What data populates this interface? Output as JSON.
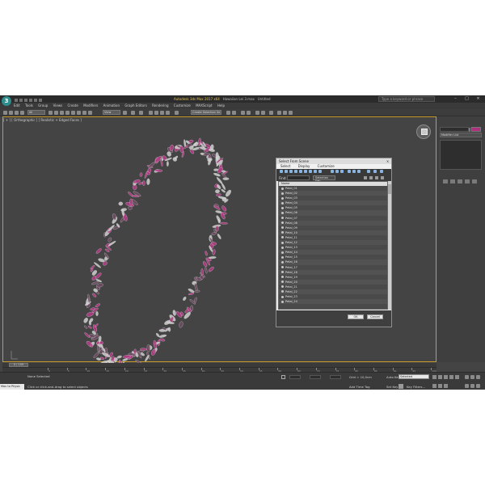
{
  "app": {
    "title_prefix": "Autodesk 3ds Max 2017 x64",
    "title_file": "Hawaiian Lei 3.max",
    "title_mode": "Untitled",
    "search_placeholder": "Type a keyword or phrase",
    "logo": "3"
  },
  "menu": [
    "Edit",
    "Tools",
    "Group",
    "Views",
    "Create",
    "Modifiers",
    "Animation",
    "Graph Editors",
    "Rendering",
    "Customize",
    "MAXScript",
    "Help"
  ],
  "toolbar": {
    "selection_filter": "All",
    "view": "View",
    "named_selection": "Create Selection Se"
  },
  "viewport": {
    "label": "[ + ] [ Orthographic ] [ Realistic + Edged Faces ]",
    "petal_colors": {
      "petal_light": "#cfcfcf",
      "petal_pink": "#b53c86",
      "petal_dark": "#6e4a62"
    }
  },
  "command_panel": {
    "modifier_list": "Modifier List",
    "object_color": "#b03080"
  },
  "dialog": {
    "title": "Select From Scene",
    "close": "×",
    "menu": [
      "Select",
      "Display",
      "Customize"
    ],
    "find_label": "Find:",
    "selection_set": "Selection Set:",
    "column_name": "Name",
    "items": [
      "Petal_01",
      "Petal_02",
      "Petal_03",
      "Petal_04",
      "Petal_05",
      "Petal_06",
      "Petal_07",
      "Petal_08",
      "Petal_09",
      "Petal_10",
      "Petal_11",
      "Petal_12",
      "Petal_13",
      "Petal_14",
      "Petal_15",
      "Petal_16",
      "Petal_17",
      "Petal_18",
      "Petal_19",
      "Petal_20",
      "Petal_21",
      "Petal_22",
      "Petal_23",
      "Petal_24"
    ],
    "ok": "OK",
    "cancel": "Cancel"
  },
  "timeline": {
    "slider": "0 / 100",
    "ticks": [
      "0",
      "5",
      "10",
      "15",
      "20",
      "25",
      "30",
      "35",
      "40",
      "45",
      "50",
      "55",
      "60",
      "65",
      "70",
      "75",
      "80",
      "85",
      "90",
      "95",
      "100"
    ]
  },
  "status": {
    "maxscript": "Max to Physic",
    "selection": "None Selected",
    "hint": "Click or click-and-drag to select objects",
    "grid": "Grid = 10,0cm",
    "add_time_tag": "Add Time Tag",
    "auto_key": "Auto Key",
    "selected": "Selected",
    "set_key": "Set Key",
    "key_filters": "Key Filters..."
  }
}
